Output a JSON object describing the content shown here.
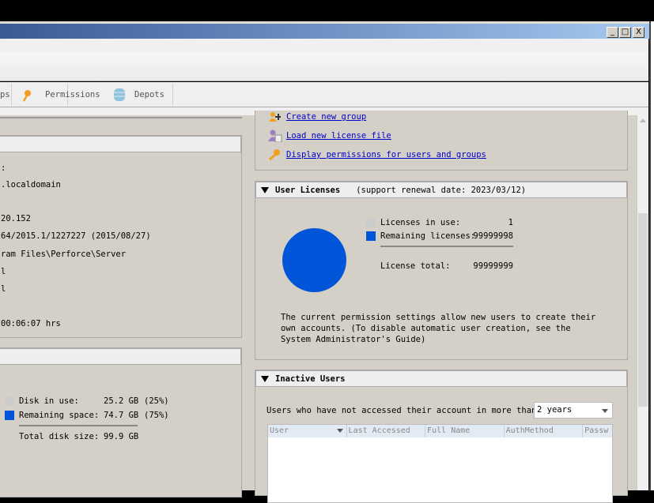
{
  "window": {
    "minimize": "_",
    "maximize": "□",
    "close": "X"
  },
  "tabs": [
    {
      "label": "ps",
      "icon": "groups-icon"
    },
    {
      "label": "Permissions",
      "icon": "key-icon"
    },
    {
      "label": "Depots",
      "icon": "database-icon"
    }
  ],
  "server_info": {
    "lines": [
      ":",
      ".localdomain",
      "20.152",
      "64/2015.1/1227227 (2015/08/27)",
      "ram Files\\Perforce\\Server",
      "l",
      "l",
      "00:06:07 hrs"
    ]
  },
  "disk": {
    "in_use_label": "Disk in use:",
    "in_use_value": "25.2 GB",
    "in_use_pct": "(25%)",
    "remaining_label": "Remaining space:",
    "remaining_value": "74.7 GB",
    "remaining_pct": "(75%)",
    "total_label": "Total disk size:",
    "total_value": "99.9 GB",
    "used_fraction": 0.25
  },
  "actions": [
    {
      "label": "Create new group",
      "icon": "create-group-icon"
    },
    {
      "label": "Load new license file",
      "icon": "license-file-icon"
    },
    {
      "label": "Display permissions for users and groups",
      "icon": "key-icon"
    }
  ],
  "licenses": {
    "title": "User Licenses",
    "renewal": "(support renewal date: 2023/03/12)",
    "in_use_label": "Licenses in use:",
    "in_use_value": "1",
    "remaining_label": "Remaining licenses:",
    "remaining_value": "99999998",
    "total_label": "License total:",
    "total_value": "99999999",
    "note": "The current permission settings allow new users to create their own accounts. (To disable automatic user creation, see the System Administrator's Guide)"
  },
  "inactive": {
    "title": "Inactive Users",
    "prompt": "Users who have not accessed their account in more than:",
    "period": "2 years",
    "columns": [
      "User",
      "Last Accessed",
      "Full Name",
      "AuthMethod",
      "Passw"
    ]
  },
  "colors": {
    "used": "#cccccc",
    "remaining": "#0055d9"
  }
}
